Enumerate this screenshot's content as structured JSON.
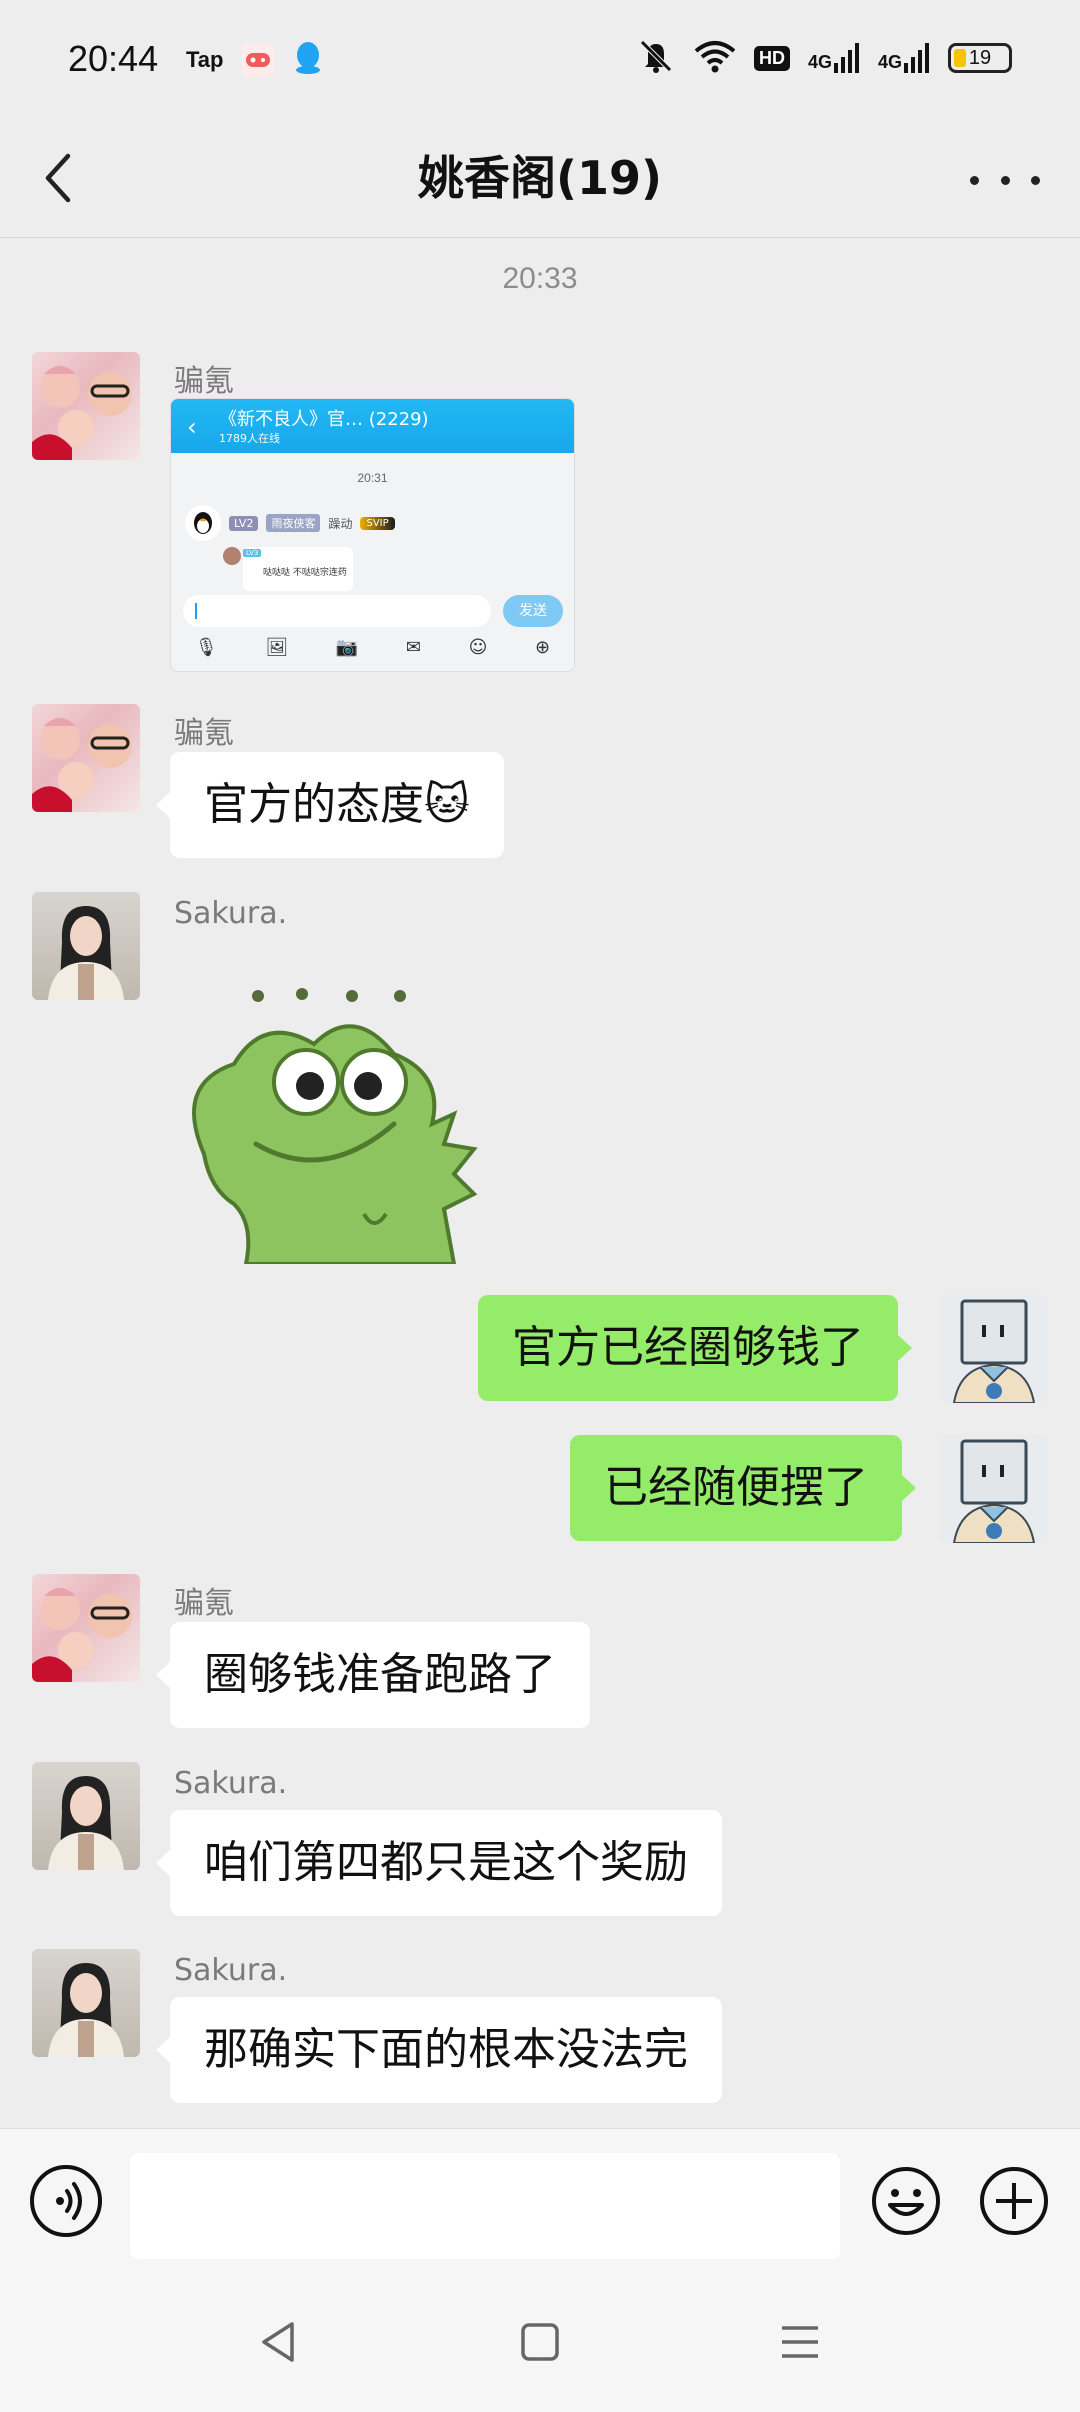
{
  "status_bar": {
    "time": "20:44",
    "tap_label": "Tap",
    "hd_label": "HD",
    "signal1": "4G",
    "signal2": "4G",
    "battery": "19",
    "colors": {
      "battery_fill": "#f7c400"
    }
  },
  "header": {
    "title": "姚香阁(19)"
  },
  "chat": {
    "timestamp": "20:33",
    "messages": [
      {
        "sender": "骗氪",
        "type": "image"
      },
      {
        "sender": "骗氪",
        "text": "官方的态度🐱"
      },
      {
        "sender": "Sakura.",
        "type": "sticker"
      },
      {
        "side": "self",
        "text": "官方已经圈够钱了"
      },
      {
        "side": "self",
        "text": "已经随便摆了"
      },
      {
        "sender": "骗氪",
        "text": "圈够钱准备跑路了"
      },
      {
        "sender": "Sakura.",
        "text": "咱们第四都只是这个奖励"
      },
      {
        "sender": "Sakura.",
        "text": "那确实下面的根本没法完"
      }
    ],
    "shared_image": {
      "title": "《新不良人》官…  (2229)",
      "online": "1789人在线",
      "time": "20:31",
      "level": "LV2",
      "role": "雨夜侠客",
      "name": "躁动",
      "vip": "SVIP",
      "reply_level": "LV3",
      "reply_text": "哒哒哒 不哒哒宗连药",
      "send_label": "发送"
    }
  },
  "input_bar": {
    "placeholder": ""
  },
  "colors": {
    "self_bubble": "#95ec69",
    "other_bubble": "#ffffff",
    "background": "#ededed"
  }
}
